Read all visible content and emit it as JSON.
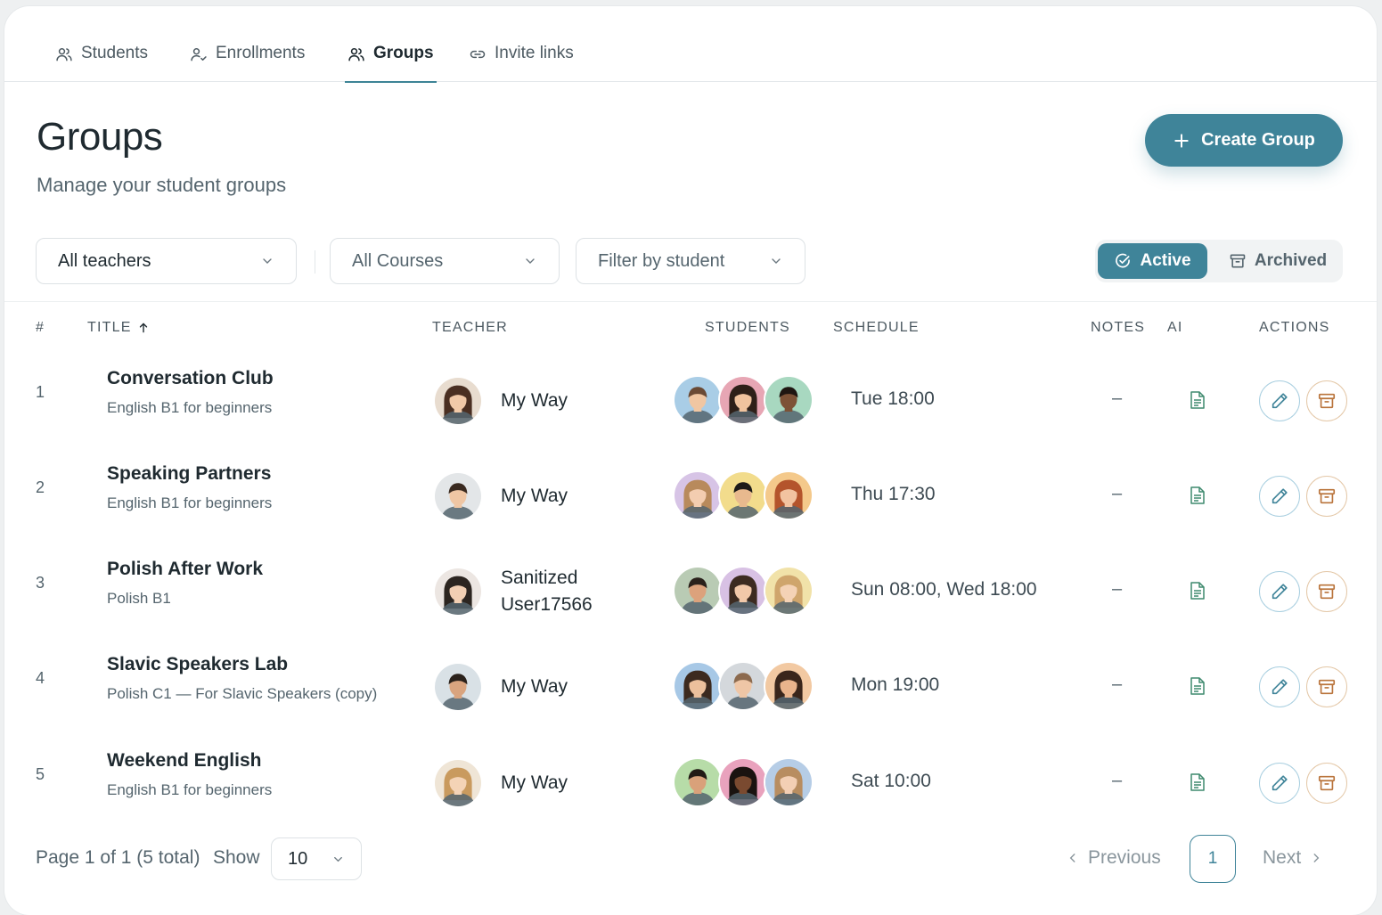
{
  "tabs": [
    {
      "label": "Students",
      "icon": "users-icon",
      "active": false
    },
    {
      "label": "Enrollments",
      "icon": "user-check-icon",
      "active": false
    },
    {
      "label": "Groups",
      "icon": "users-icon",
      "active": true
    },
    {
      "label": "Invite links",
      "icon": "link-icon",
      "active": false
    }
  ],
  "header": {
    "title": "Groups",
    "subtitle": "Manage your student groups",
    "create_label": "Create Group"
  },
  "filters": {
    "teacher": "All teachers",
    "course": "All Courses",
    "student": "Filter by student"
  },
  "status_toggle": {
    "active_label": "Active",
    "archived_label": "Archived",
    "selected": "Active"
  },
  "columns": {
    "num": "#",
    "title": "TITLE",
    "teacher": "TEACHER",
    "students": "STUDENTS",
    "schedule": "SCHEDULE",
    "notes": "NOTES",
    "ai": "AI",
    "actions": "ACTIONS"
  },
  "rows": [
    {
      "num": "1",
      "title": "Conversation Club",
      "course": "English B1 for beginners",
      "teacher_line1": "My Way",
      "teacher_line2": "",
      "schedule": "Tue 18:00",
      "notes": "–"
    },
    {
      "num": "2",
      "title": "Speaking Partners",
      "course": "English B1 for beginners",
      "teacher_line1": "My Way",
      "teacher_line2": "",
      "schedule": "Thu 17:30",
      "notes": "–"
    },
    {
      "num": "3",
      "title": "Polish After Work",
      "course": "Polish B1",
      "teacher_line1": "Sanitized",
      "teacher_line2": "User17566",
      "schedule": "Sun 08:00, Wed 18:00",
      "notes": "–"
    },
    {
      "num": "4",
      "title": "Slavic Speakers Lab",
      "course": "Polish C1 — For Slavic Speakers (copy)",
      "teacher_line1": "My Way",
      "teacher_line2": "",
      "schedule": "Mon 19:00",
      "notes": "–"
    },
    {
      "num": "5",
      "title": "Weekend English",
      "course": "English B1 for beginners",
      "teacher_line1": "My Way",
      "teacher_line2": "",
      "schedule": "Sat 10:00",
      "notes": "–"
    }
  ],
  "footer": {
    "page_info": "Page 1 of 1 (5 total)",
    "show_label": "Show",
    "page_size": "10",
    "prev_label": "Previous",
    "current_page": "1",
    "next_label": "Next"
  },
  "colors": {
    "accent": "#3f8499",
    "edit_ring": "#a9cfe0",
    "archive_ring": "#e4c8a8",
    "archive_icon": "#b9733a",
    "ai_icon": "#3f8a6e"
  }
}
